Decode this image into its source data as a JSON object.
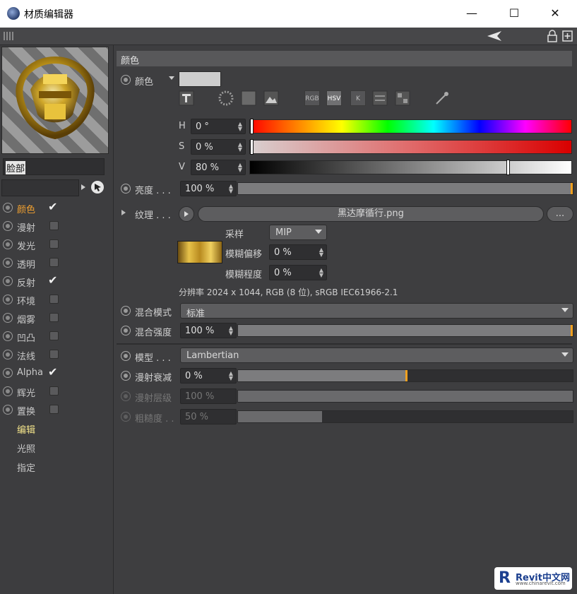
{
  "window": {
    "title": "材质编辑器",
    "minimize": "—",
    "maximize": "☐",
    "close": "✕"
  },
  "material": {
    "name": "脸部"
  },
  "channels": [
    {
      "label": "颜色",
      "checked": true,
      "active": true
    },
    {
      "label": "漫射",
      "checked": false
    },
    {
      "label": "发光",
      "checked": false
    },
    {
      "label": "透明",
      "checked": false
    },
    {
      "label": "反射",
      "checked": true
    },
    {
      "label": "环境",
      "checked": false
    },
    {
      "label": "烟雾",
      "checked": false
    },
    {
      "label": "凹凸",
      "checked": false
    },
    {
      "label": "法线",
      "checked": false
    },
    {
      "label": "Alpha",
      "checked": true
    },
    {
      "label": "辉光",
      "checked": false
    },
    {
      "label": "置换",
      "checked": false
    }
  ],
  "links": [
    {
      "label": "编辑",
      "selected": true
    },
    {
      "label": "光照"
    },
    {
      "label": "指定"
    }
  ],
  "color_section": {
    "header": "颜色",
    "color_label": "颜色",
    "swatch_color": "#cdcdcd",
    "mode_buttons": [
      "RGB",
      "HSV",
      "K"
    ],
    "h": {
      "label": "H",
      "value": "0 °",
      "marker": 0.0
    },
    "s": {
      "label": "S",
      "value": "0 %",
      "marker": 0.0
    },
    "v": {
      "label": "V",
      "value": "80 %",
      "marker": 0.8
    },
    "brightness": {
      "label": "亮度 . . .",
      "value": "100 %",
      "fill": 1.0
    },
    "texture": {
      "label": "纹理 . . .",
      "file": "黑达摩循行.png",
      "more": "...",
      "sampling_label": "采样",
      "sampling_value": "MIP",
      "blur_offset_label": "模糊偏移",
      "blur_offset_value": "0 %",
      "blur_degree_label": "模糊程度",
      "blur_degree_value": "0 %",
      "info": "分辨率 2024 x 1044, RGB (8 位), sRGB IEC61966-2.1"
    },
    "blend_mode": {
      "label": "混合模式",
      "value": "标准"
    },
    "blend_strength": {
      "label": "混合强度",
      "value": "100 %",
      "fill": 1.0
    }
  },
  "model_section": {
    "model": {
      "label": "模型 . . .",
      "value": "Lambertian"
    },
    "diffuse_falloff": {
      "label": "漫射衰减",
      "value": "0 %",
      "fill": 0.5
    },
    "diffuse_level": {
      "label": "漫射层级",
      "value": "100 %",
      "fill": 1.0
    },
    "roughness": {
      "label": "粗糙度 . .",
      "value": "50 %",
      "fill": 0.25
    }
  },
  "watermark": {
    "title": "Revit中文网",
    "url": "www.chinarevit.com"
  }
}
